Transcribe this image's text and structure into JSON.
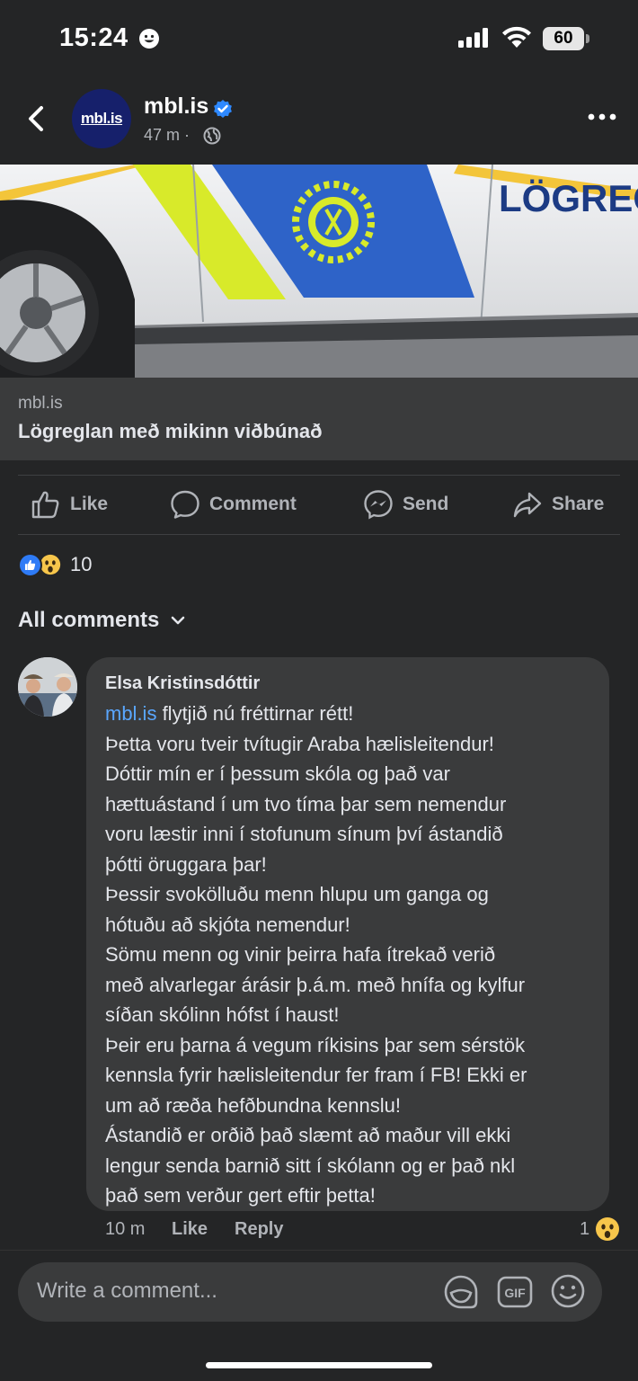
{
  "status_bar": {
    "time": "15:24",
    "battery": "60"
  },
  "post": {
    "page_name": "mbl.is",
    "avatar_text": "mbl.is",
    "time": "47 m",
    "meta_separator": "·",
    "image_vehicle_text": "LÖGREG",
    "link": {
      "domain": "mbl.is",
      "title": "Lögreglan með mikinn viðbúnað"
    }
  },
  "actions": {
    "like": "Like",
    "comment": "Comment",
    "send": "Send",
    "share": "Share"
  },
  "reactions": {
    "count": "10"
  },
  "comments_header": "All comments",
  "comment": {
    "author": "Elsa Kristinsdóttir",
    "mention": "mbl.is",
    "lines": [
      " flytjið nú fréttirnar rétt!",
      "Þetta voru tveir tvítugir Araba hælisleitendur!",
      "Dóttir mín er í þessum skóla og það var",
      "hættuástand í um tvo tíma þar sem nemendur",
      "voru læstir inni í stofunum sínum því ástandið",
      "þótti öruggara þar!",
      "Þessir svokölluðu menn hlupu um ganga og",
      "hótuðu að skjóta nemendur!",
      "Sömu menn og vinir þeirra hafa ítrekað verið",
      "með alvarlegar árásir þ.á.m. með hnífa og kylfur",
      "síðan skólinn hófst í haust!",
      "Þeir eru þarna á vegum ríkisins þar sem sérstök",
      "kennsla fyrir hælisleitendur fer fram í FB! Ekki er",
      "um að ræða hefðbundna kennslu!",
      "Ástandið er orðið það slæmt að maður vill ekki",
      "lengur senda barnið sitt í skólann og er það nkl",
      "það sem verður gert eftir þetta!"
    ],
    "time": "10 m",
    "like": "Like",
    "reply": "Reply",
    "reaction_count": "1"
  },
  "composer": {
    "placeholder": "Write a comment...",
    "gif": "GIF"
  },
  "colors": {
    "background": "#242526",
    "surface": "#3a3b3c",
    "link": "#5aa7ff",
    "like_blue": "#2e7bf6",
    "verified": "#2e89ff"
  }
}
